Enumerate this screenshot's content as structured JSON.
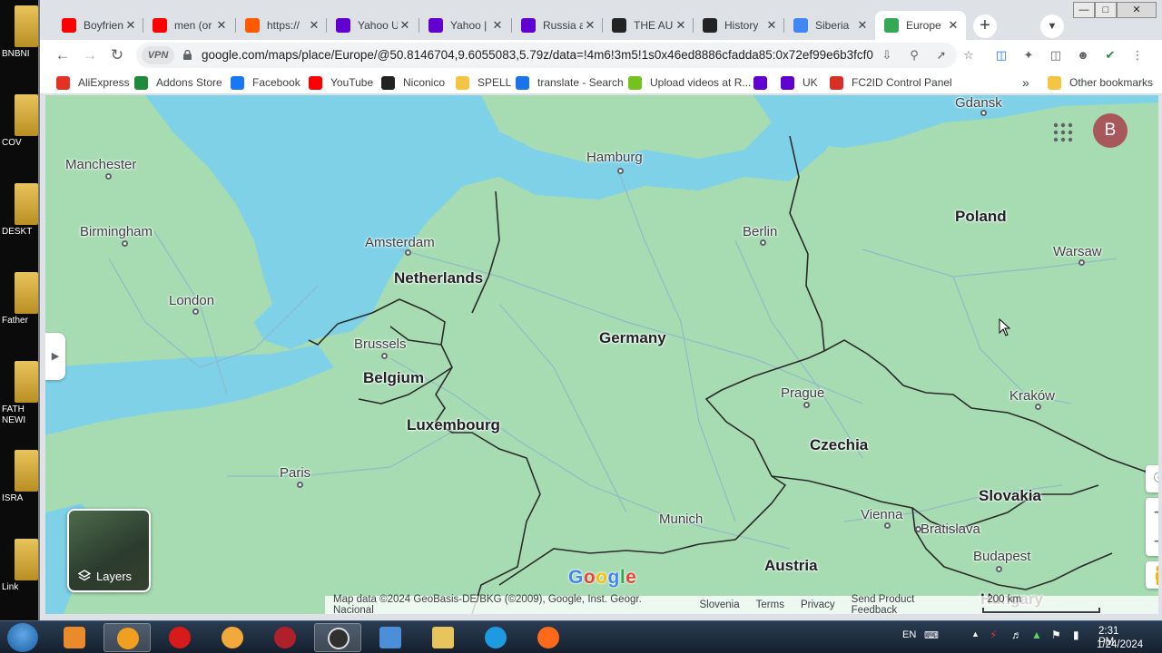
{
  "desktop": {
    "icons": [
      {
        "label": "BNBNI"
      },
      {
        "label": "COV"
      },
      {
        "label": "DESKT"
      },
      {
        "label": "Father"
      },
      {
        "label": "FATH NEWI"
      },
      {
        "label": "ISRA"
      },
      {
        "label": "Link"
      }
    ]
  },
  "tabs": [
    {
      "title": "Boyfrien",
      "icon": "youtube-icon",
      "color": "#ff0000"
    },
    {
      "title": "men (or",
      "icon": "youtube-icon",
      "color": "#ff0000"
    },
    {
      "title": "https://",
      "icon": "alibaba-icon",
      "color": "#ff5a00"
    },
    {
      "title": "Yahoo U",
      "icon": "yahoo-icon",
      "color": "#6001d2"
    },
    {
      "title": "Yahoo |",
      "icon": "yahoo-icon",
      "color": "#6001d2"
    },
    {
      "title": "Russia a",
      "icon": "yahoo-icon",
      "color": "#6001d2"
    },
    {
      "title": "THE AU",
      "icon": "publication-icon",
      "color": "#222222"
    },
    {
      "title": "History",
      "icon": "wikipedia-icon",
      "color": "#222222"
    },
    {
      "title": "Siberia",
      "icon": "google-icon",
      "color": "#4285f4"
    },
    {
      "title": "Europe",
      "icon": "google-maps-icon",
      "color": "#34a853",
      "active": true
    }
  ],
  "toolbar": {
    "vpn_label": "VPN",
    "url": "google.com/maps/place/Europe/@50.8146704,9.6055083,5.79z/data=!4m6!3m5!1s0x46ed8886cfadda85:0x72ef99e6b3fcf079!..."
  },
  "bookmarks": [
    {
      "label": "AliExpress",
      "color": "#e43225"
    },
    {
      "label": "Addons Store",
      "color": "#1f8a3b"
    },
    {
      "label": "Facebook",
      "color": "#1877f2"
    },
    {
      "label": "YouTube",
      "color": "#ff0000"
    },
    {
      "label": "Niconico",
      "color": "#222222"
    },
    {
      "label": "SPELL",
      "color": "#f4c542"
    },
    {
      "label": "translate - Search",
      "color": "#1a73e8"
    },
    {
      "label": "Upload videos at R...",
      "color": "#74c21d"
    },
    {
      "label": "",
      "color": "#6001d2"
    },
    {
      "label": "UK",
      "color": "#6001d2"
    },
    {
      "label": "FC2ID Control Panel",
      "color": "#d93025"
    }
  ],
  "bookmarks_more": "»",
  "other_bookmarks": "Other bookmarks",
  "map": {
    "avatar_letter": "B",
    "layers_label": "Layers",
    "places": [
      {
        "name": "Gdansk",
        "kind": "city"
      },
      {
        "name": "Manchester",
        "kind": "city"
      },
      {
        "name": "Hamburg",
        "kind": "city"
      },
      {
        "name": "Poland",
        "kind": "country"
      },
      {
        "name": "Birmingham",
        "kind": "city"
      },
      {
        "name": "Amsterdam",
        "kind": "city"
      },
      {
        "name": "Berlin",
        "kind": "city"
      },
      {
        "name": "Warsaw",
        "kind": "city"
      },
      {
        "name": "Netherlands",
        "kind": "country"
      },
      {
        "name": "London",
        "kind": "city"
      },
      {
        "name": "Brussels",
        "kind": "city"
      },
      {
        "name": "Germany",
        "kind": "country"
      },
      {
        "name": "Belgium",
        "kind": "country"
      },
      {
        "name": "Prague",
        "kind": "city"
      },
      {
        "name": "Kraków",
        "kind": "city"
      },
      {
        "name": "Luxembourg",
        "kind": "country"
      },
      {
        "name": "Czechia",
        "kind": "country"
      },
      {
        "name": "Paris",
        "kind": "city"
      },
      {
        "name": "Slovakia",
        "kind": "country"
      },
      {
        "name": "Munich",
        "kind": "city"
      },
      {
        "name": "Vienna",
        "kind": "city"
      },
      {
        "name": "Bratislava",
        "kind": "city"
      },
      {
        "name": "Budapest",
        "kind": "city"
      },
      {
        "name": "Austria",
        "kind": "country"
      },
      {
        "name": "Hungary",
        "kind": "country"
      }
    ],
    "attribution": {
      "data": "Map data ©2024 GeoBasis-DE/BKG (©2009), Google, Inst. Geogr. Nacional",
      "region": "Slovenia",
      "terms": "Terms",
      "privacy": "Privacy",
      "feedback": "Send Product Feedback",
      "scale": "200 km"
    },
    "colors": {
      "land": "#a7dcb2",
      "water": "#7fd1e8",
      "border": "#2b2b2b",
      "road": "#8fb7c9"
    }
  },
  "taskbar": {
    "lang": "EN",
    "time": "2:31 PM",
    "date": "1/24/2024"
  }
}
